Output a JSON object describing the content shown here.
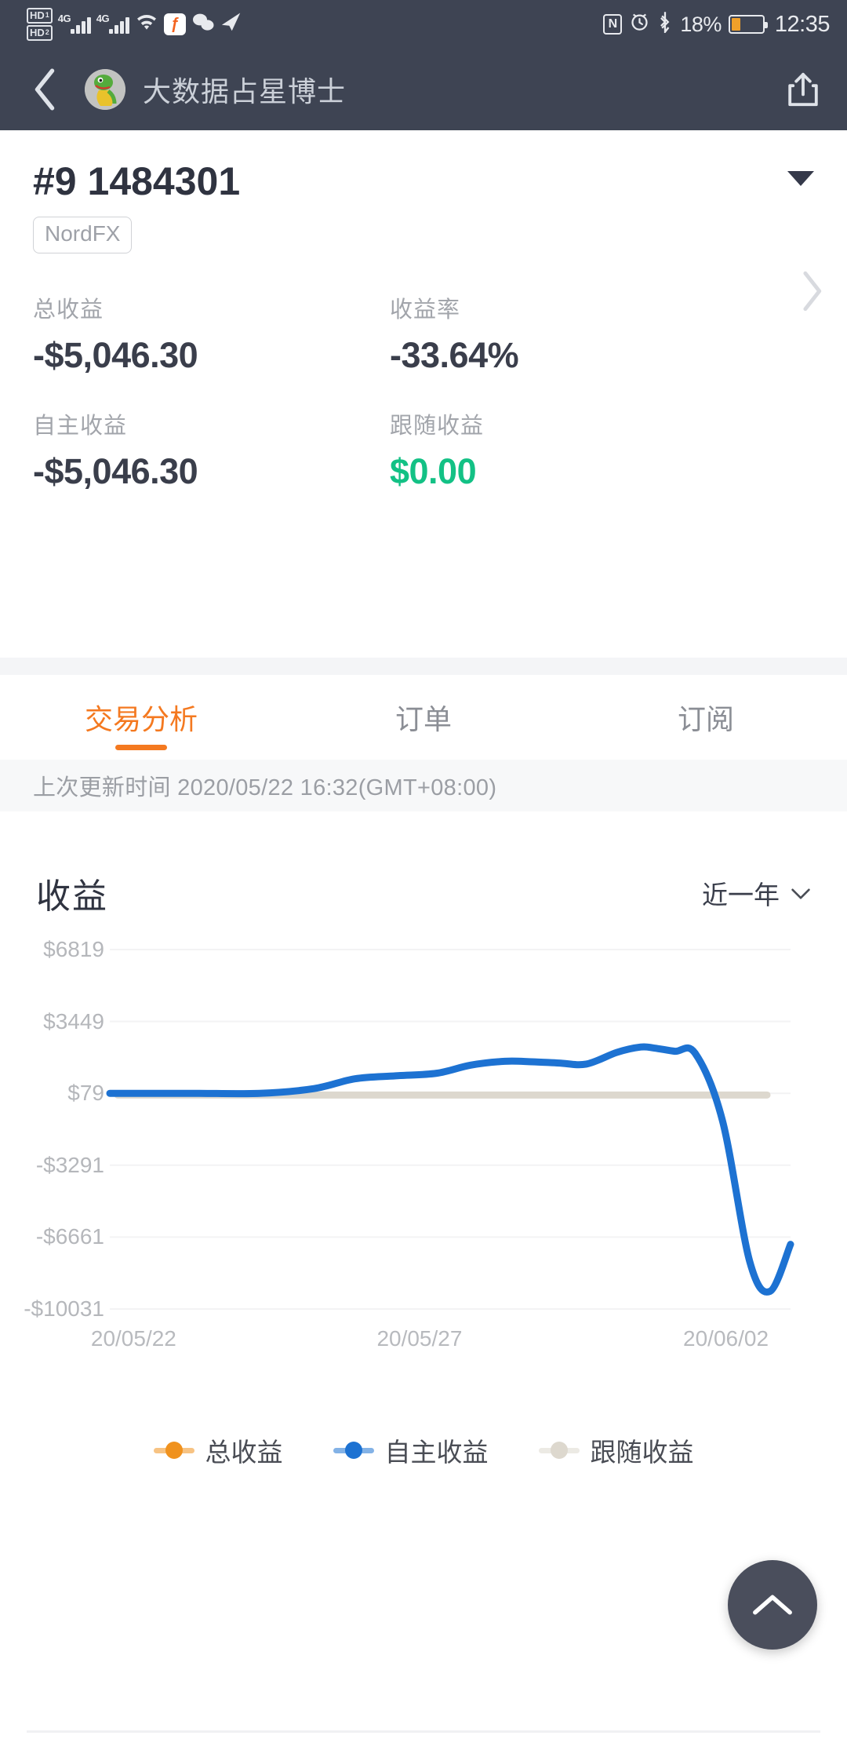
{
  "status_bar": {
    "hd1_label": "HD",
    "hd1_sub": "1",
    "hd2_label": "HD",
    "hd2_sub": "2",
    "net1": "4G",
    "net2": "4G",
    "icons": [
      "hd-volte-icon",
      "signal-4g-icon",
      "signal-4g-icon",
      "wifi-icon",
      "app-icon",
      "wechat-icon",
      "telegram-icon"
    ],
    "nfc": "N",
    "battery_percent": "18%",
    "time": "12:35"
  },
  "appbar": {
    "back_icon": "back-chevron-icon",
    "title": "大数据占星博士",
    "share_icon": "share-icon"
  },
  "account": {
    "id": "#9 1484301",
    "broker": "NordFX",
    "expand_icon": "caret-down-icon",
    "detail_icon": "chevron-right-icon",
    "stats": [
      {
        "label": "总收益",
        "value": "-$5,046.30",
        "color": "#3a3e4b"
      },
      {
        "label": "收益率",
        "value": "-33.64%",
        "color": "#3a3e4b"
      },
      {
        "label": "自主收益",
        "value": "-$5,046.30",
        "color": "#3a3e4b"
      },
      {
        "label": "跟随收益",
        "value": "$0.00",
        "color": "#13c185"
      }
    ]
  },
  "tabs": {
    "items": [
      {
        "label": "交易分析",
        "active": true
      },
      {
        "label": "订单",
        "active": false
      },
      {
        "label": "订阅",
        "active": false
      }
    ],
    "active_color": "#f47920",
    "inactive_color": "#8b8e95"
  },
  "update_bar": {
    "text": "上次更新时间 2020/05/22 16:32(GMT+08:00)"
  },
  "chart_header": {
    "title": "收益",
    "range_label": "近一年",
    "range_icon": "chevron-down-icon"
  },
  "fab": {
    "icon": "scroll-to-top-icon"
  },
  "chart_data": {
    "type": "line",
    "title": "收益",
    "xlabel": "",
    "ylabel": "",
    "grid": true,
    "legend_position": "bottom",
    "ylim": [
      -10031,
      6819
    ],
    "yticks": [
      6819,
      3449,
      79,
      -3291,
      -6661,
      -10031
    ],
    "ytick_labels": [
      "$6819",
      "$3449",
      "$79",
      "-$3291",
      "-$6661",
      "-$10031"
    ],
    "xticks": [
      0,
      5,
      11
    ],
    "xtick_labels": [
      "20/05/22",
      "20/05/27",
      "20/06/02"
    ],
    "series": [
      {
        "name": "总收益",
        "color": "#f0921e",
        "legend_label": "总收益",
        "values": []
      },
      {
        "name": "自主收益",
        "color": "#1d72d2",
        "legend_label": "自主收益",
        "x": [
          0.0,
          0.12,
          0.22,
          0.3,
          0.36,
          0.42,
          0.48,
          0.53,
          0.58,
          0.62,
          0.66,
          0.7,
          0.745,
          0.78,
          0.8,
          0.83,
          0.86,
          0.9,
          0.94,
          0.97,
          1.0
        ],
        "values": [
          79,
          79,
          79,
          300,
          760,
          900,
          1020,
          1400,
          1580,
          1560,
          1500,
          1450,
          2000,
          2250,
          2200,
          2050,
          1950,
          -1200,
          -7800,
          -9200,
          -7000
        ]
      },
      {
        "name": "跟随收益",
        "color": "#ddd8ce",
        "legend_label": "跟随收益",
        "values": [
          0,
          0,
          0,
          0,
          0,
          0,
          0,
          0,
          0,
          0,
          0,
          0
        ]
      }
    ]
  }
}
